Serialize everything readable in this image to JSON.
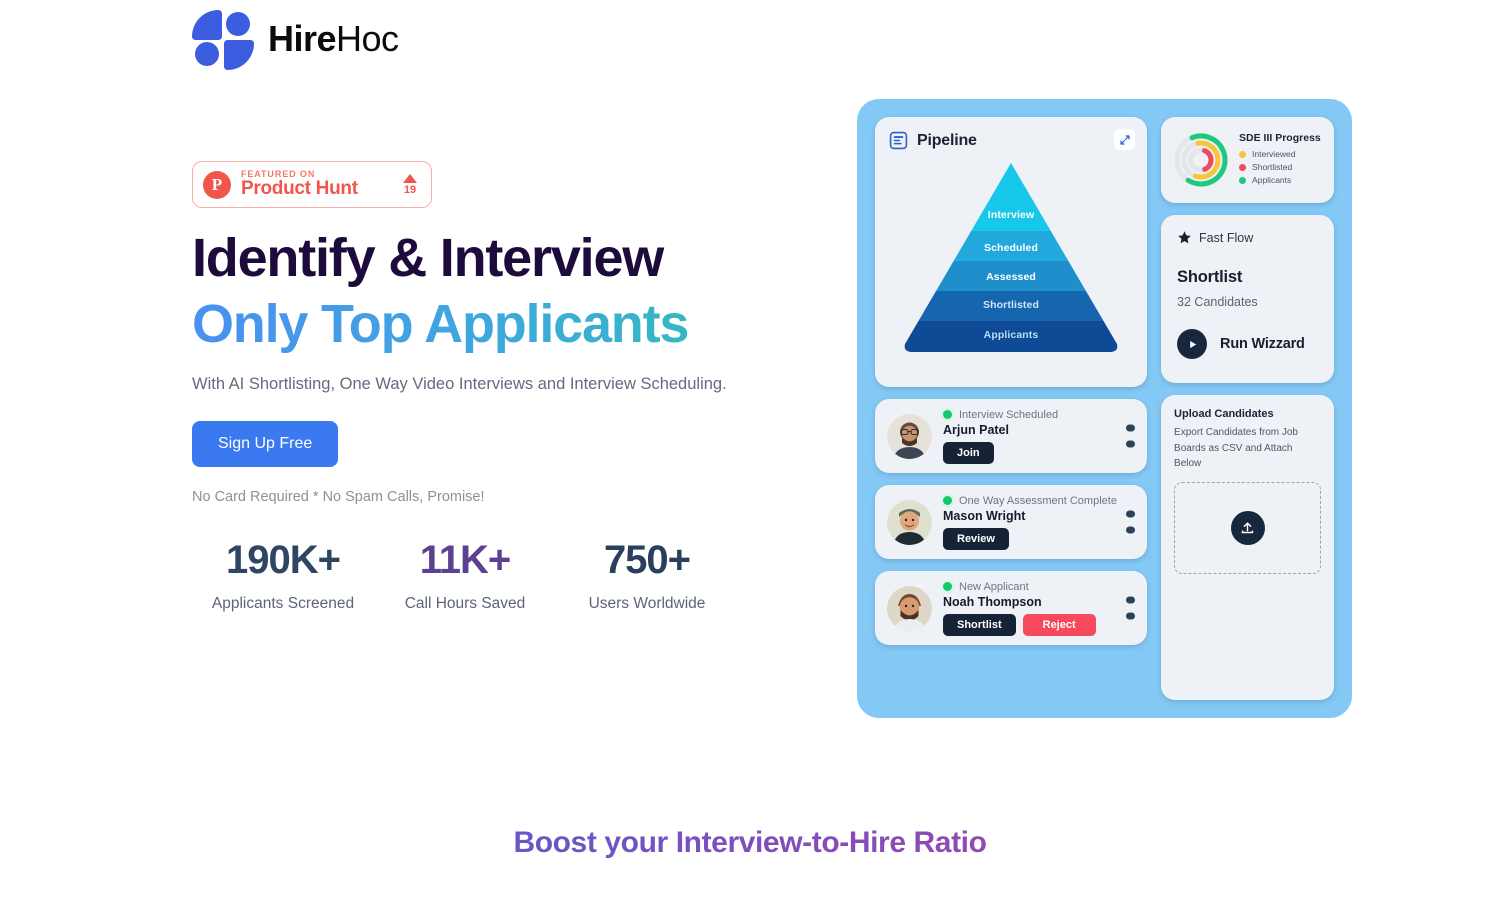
{
  "brand": {
    "name_bold": "Hire",
    "name_light": "Hoc",
    "logo_icon": "hirehoc-logo-mark",
    "accent": "#3d5de0"
  },
  "badge": {
    "logo_letter": "P",
    "kicker": "FEATURED ON",
    "name": "Product Hunt",
    "upvotes": "19",
    "color": "#f2554a"
  },
  "hero": {
    "headline_line1": "Identify & Interview",
    "headline_line2": "Only Top Applicants",
    "subhead": "With AI Shortlisting, One Way Video Interviews and Interview Scheduling.",
    "cta_label": "Sign Up Free",
    "cta_color": "#3b79f0",
    "fineprint": "No Card Required * No Spam Calls, Promise!"
  },
  "stats": [
    {
      "value": "190K+",
      "label": "Applicants Screened",
      "color": "#2e4663"
    },
    {
      "value": "11K+",
      "label": "Call Hours Saved",
      "color": "#5b4190"
    },
    {
      "value": "750+",
      "label": "Users Worldwide",
      "color": "#2a3f5e"
    }
  ],
  "mockup": {
    "panel_color": "#84c9f5",
    "pipeline": {
      "icon": "document-lines-icon",
      "title": "Pipeline",
      "expand_icon": "expand-arrows-icon",
      "stages": [
        {
          "label": "Interview",
          "color": "#18c8ea"
        },
        {
          "label": "Scheduled",
          "color": "#23a8dd"
        },
        {
          "label": "Assessed",
          "color": "#1e8fcb"
        },
        {
          "label": "Shortlisted",
          "color": "#1566ae"
        },
        {
          "label": "Applicants",
          "color": "#0e4a96"
        }
      ]
    },
    "notifications": [
      {
        "avatar": "avatar-arjun-patel",
        "status": "Interview Scheduled",
        "name": "Arjun Patel",
        "actions": [
          {
            "label": "Join",
            "style": "dark"
          }
        ],
        "kebab_icon": "more-options-icon"
      },
      {
        "avatar": "avatar-mason-wright",
        "status": "One Way Assessment Complete",
        "name": "Mason Wright",
        "actions": [
          {
            "label": "Review",
            "style": "dark"
          }
        ],
        "kebab_icon": "more-options-icon"
      },
      {
        "avatar": "avatar-noah-thompson",
        "status": "New Applicant",
        "name": "Noah Thompson",
        "actions": [
          {
            "label": "Shortlist",
            "style": "dark"
          },
          {
            "label": "Reject",
            "style": "red"
          }
        ],
        "kebab_icon": "more-options-icon"
      }
    ],
    "progress": {
      "chart_icon": "concentric-rings-chart",
      "title": "SDE III Progress",
      "legend": [
        {
          "label": "Interviewed",
          "color": "#f7c53c"
        },
        {
          "label": "Shortlisted",
          "color": "#f2475c"
        },
        {
          "label": "Applicants",
          "color": "#1ec87e"
        }
      ]
    },
    "fast_flow": {
      "star_icon": "star-icon",
      "header": "Fast Flow",
      "title": "Shortlist",
      "subtitle": "32 Candidates",
      "play_icon": "play-icon",
      "run_label": "Run Wizzard"
    },
    "upload": {
      "title": "Upload Candidates",
      "description": "Export Candidates from Job Boards as CSV and Attach Below",
      "upload_icon": "upload-icon"
    }
  },
  "footer": {
    "boost_heading": "Boost your Interview-to-Hire Ratio"
  },
  "chart_data": {
    "type": "funnel",
    "title": "Pipeline",
    "categories": [
      "Interview",
      "Scheduled",
      "Assessed",
      "Shortlisted",
      "Applicants"
    ],
    "colors": [
      "#18c8ea",
      "#23a8dd",
      "#1e8fcb",
      "#1566ae",
      "#0e4a96"
    ],
    "legend_position": "inside",
    "secondary": {
      "type": "pie",
      "title": "SDE III Progress",
      "labels": [
        "Interviewed",
        "Shortlisted",
        "Applicants"
      ],
      "colors": [
        "#f7c53c",
        "#f2475c",
        "#1ec87e"
      ]
    }
  }
}
